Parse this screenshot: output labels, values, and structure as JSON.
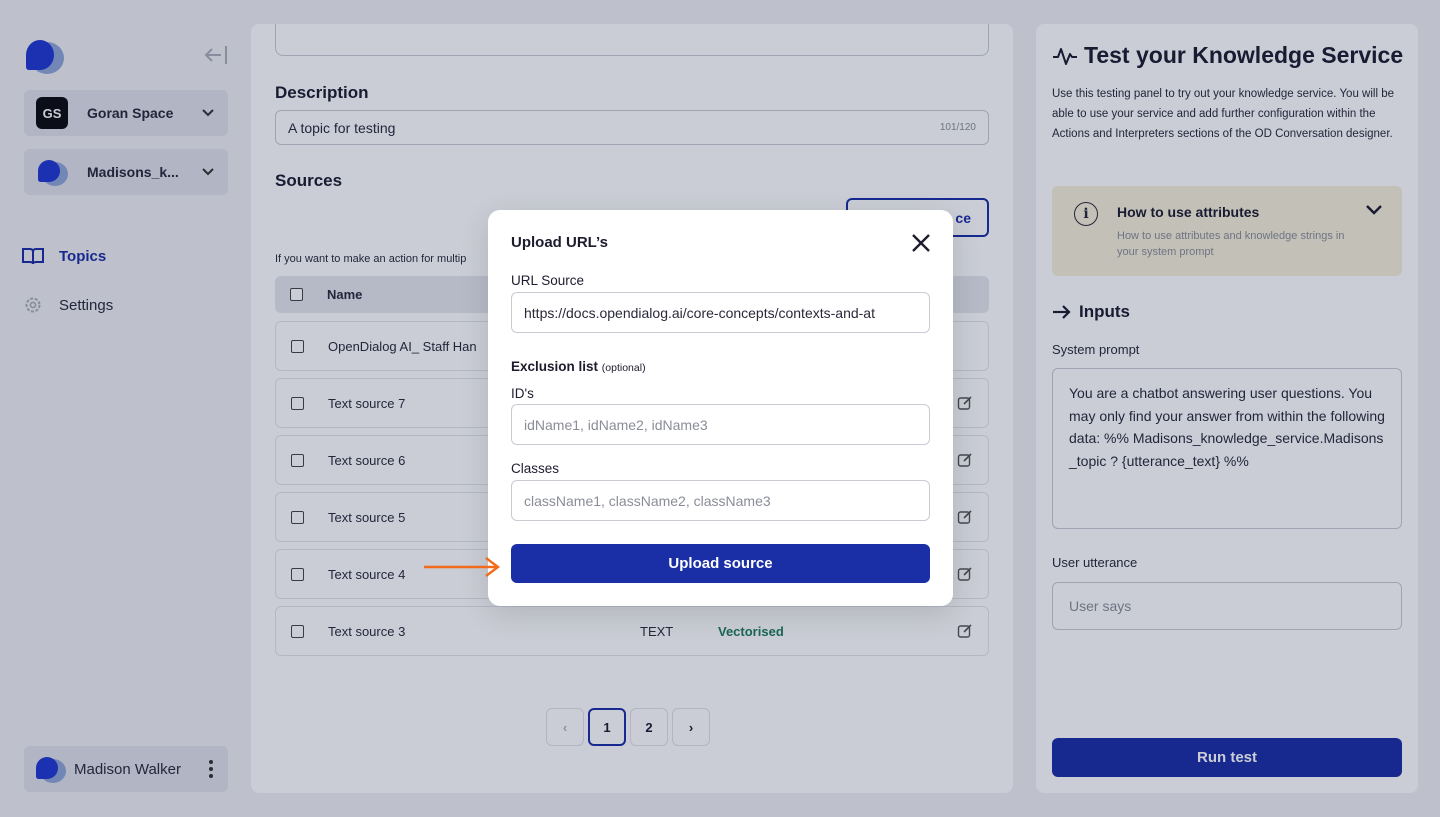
{
  "sidebar": {
    "workspace": {
      "initials": "GS",
      "name": "Goran Space"
    },
    "service": {
      "name": "Madisons_k..."
    },
    "nav": [
      {
        "label": "Topics",
        "icon": "book-icon",
        "active": true
      },
      {
        "label": "Settings",
        "icon": "gear-icon",
        "active": false
      }
    ],
    "user": {
      "name": "Madison Walker"
    }
  },
  "main": {
    "description_label": "Description",
    "description_value": "A topic for testing",
    "description_counter": "101/120",
    "sources_label": "Sources",
    "add_source_label": "ce",
    "hint": "If you want to make an action for multip",
    "table": {
      "header_name": "Name",
      "rows": [
        {
          "name": "OpenDialog AI_ Staff Han",
          "type": "",
          "status": ""
        },
        {
          "name": "Text source 7",
          "type": "",
          "status": ""
        },
        {
          "name": "Text source 6",
          "type": "",
          "status": ""
        },
        {
          "name": "Text source 5",
          "type": "",
          "status": ""
        },
        {
          "name": "Text source 4",
          "type": "",
          "status": ""
        },
        {
          "name": "Text source 3",
          "type": "TEXT",
          "status": "Vectorised"
        }
      ]
    },
    "pagination": {
      "prev": "‹",
      "pages": [
        "1",
        "2"
      ],
      "current": "1",
      "next": "›"
    }
  },
  "panel": {
    "title": "Test your Knowledge Service",
    "intro": "Use this testing panel to try out your knowledge service. You will be able to use your service and add further configuration within the Actions and Interpreters sections of the OD Conversation designer.",
    "attributes": {
      "title": "How to use attributes",
      "subtitle": "How to use attributes and knowledge strings in your system prompt"
    },
    "inputs_title": "Inputs",
    "system_prompt_label": "System prompt",
    "system_prompt_value": "You are a chatbot answering user questions. You may only find your answer from within the following data: %% Madisons_knowledge_service.Madisons_topic ? {utterance_text} %%",
    "user_utterance_label": "User utterance",
    "user_utterance_placeholder": "User says",
    "run_test_label": "Run test"
  },
  "modal": {
    "title": "Upload URL’s",
    "url_source_label": "URL Source",
    "url_source_value": "https://docs.opendialog.ai/core-concepts/contexts-and-at",
    "exclusion_label": "Exclusion list",
    "exclusion_optional": "(optional)",
    "ids_label": "ID's",
    "ids_placeholder": "idName1, idName2, idName3",
    "classes_label": "Classes",
    "classes_placeholder": "className1, className2, className3",
    "upload_label": "Upload source"
  },
  "colors": {
    "primary": "#1a2ea6",
    "status_green": "#1e7b5e",
    "attr_box": "#f6efd9",
    "arrow": "#f26b1d"
  }
}
